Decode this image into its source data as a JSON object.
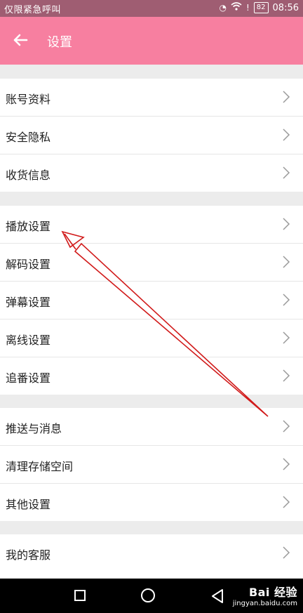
{
  "status_bar": {
    "emergency_text": "仅限紧急呼叫",
    "battery": "82",
    "time": "08:56"
  },
  "toolbar": {
    "title": "设置"
  },
  "groups": [
    {
      "items": [
        {
          "label": "账号资料"
        },
        {
          "label": "安全隐私"
        },
        {
          "label": "收货信息"
        }
      ]
    },
    {
      "items": [
        {
          "label": "播放设置"
        },
        {
          "label": "解码设置"
        },
        {
          "label": "弹幕设置"
        },
        {
          "label": "离线设置"
        },
        {
          "label": "追番设置"
        }
      ]
    },
    {
      "items": [
        {
          "label": "推送与消息"
        },
        {
          "label": "清理存储空间"
        },
        {
          "label": "其他设置"
        }
      ]
    },
    {
      "items": [
        {
          "label": "我的客服"
        }
      ]
    }
  ],
  "watermark": {
    "brand": "Bai 经验",
    "url": "jingyan.baidu.com"
  },
  "colors": {
    "toolbar": "#f77fa0",
    "status_bar": "#9f5d72",
    "annotation_arrow": "#d11a1a"
  }
}
